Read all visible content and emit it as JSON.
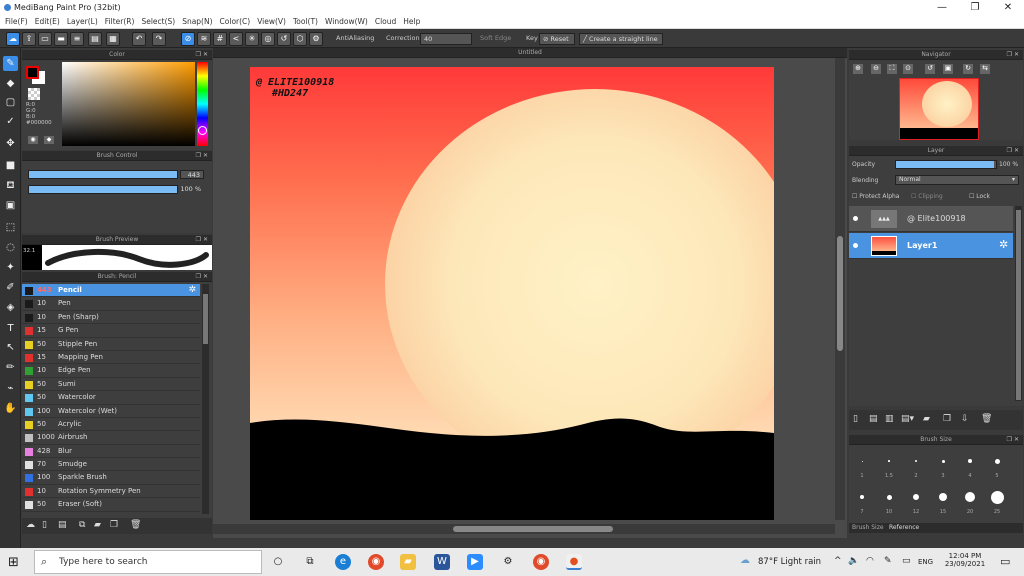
{
  "window": {
    "title": "MediBang Paint Pro (32bit)",
    "min": "—",
    "max": "❐",
    "close": "✕"
  },
  "menu": [
    "File(F)",
    "Edit(E)",
    "Layer(L)",
    "Filter(R)",
    "Select(S)",
    "Snap(N)",
    "Color(C)",
    "View(V)",
    "Tool(T)",
    "Window(W)",
    "Cloud",
    "Help"
  ],
  "toolbar": {
    "antialiasing": "AntiAliasing",
    "correction": "Correction",
    "correction_value": "40",
    "soft_edge": "Soft Edge",
    "key": "Key",
    "reset": "Reset",
    "straight_line": "Create a straight line"
  },
  "color_panel": {
    "title": "Color",
    "r": "R:0",
    "g": "G:0",
    "b": "B:0",
    "hex": "#000000"
  },
  "brush_control": {
    "title": "Brush Control",
    "size": "443",
    "opacity": "100 %"
  },
  "brush_preview": {
    "title": "Brush Preview",
    "size": "32.1"
  },
  "brush_list": {
    "title": "Brush: Pencil",
    "items": [
      {
        "size": "443",
        "name": "Pencil",
        "color": "#1a1a1a"
      },
      {
        "size": "10",
        "name": "Pen",
        "color": "#1a1a1a"
      },
      {
        "size": "10",
        "name": "Pen (Sharp)",
        "color": "#1a1a1a"
      },
      {
        "size": "15",
        "name": "G Pen",
        "color": "#e03030"
      },
      {
        "size": "50",
        "name": "Stipple Pen",
        "color": "#e8d020"
      },
      {
        "size": "15",
        "name": "Mapping Pen",
        "color": "#e03030"
      },
      {
        "size": "10",
        "name": "Edge Pen",
        "color": "#30a030"
      },
      {
        "size": "50",
        "name": "Sumi",
        "color": "#e8d020"
      },
      {
        "size": "50",
        "name": "Watercolor",
        "color": "#60c8f0"
      },
      {
        "size": "100",
        "name": "Watercolor (Wet)",
        "color": "#60c8f0"
      },
      {
        "size": "50",
        "name": "Acrylic",
        "color": "#e8d020"
      },
      {
        "size": "1000",
        "name": "Airbrush",
        "color": "#c0c0c0"
      },
      {
        "size": "428",
        "name": "Blur",
        "color": "#e880e0"
      },
      {
        "size": "70",
        "name": "Smudge",
        "color": "#e0e0e0"
      },
      {
        "size": "100",
        "name": "Sparkle Brush",
        "color": "#3070e0"
      },
      {
        "size": "10",
        "name": "Rotation Symmetry Pen",
        "color": "#e03030"
      },
      {
        "size": "50",
        "name": "Eraser (Soft)",
        "color": "#e0e0e0"
      }
    ]
  },
  "canvas": {
    "title": "Untitled",
    "sig1": "@ ELITE100918",
    "sig2": "#HD247"
  },
  "navigator": {
    "title": "Navigator"
  },
  "layer_panel": {
    "title": "Layer",
    "opacity_label": "Opacity",
    "opacity_value": "100 %",
    "blending_label": "Blending",
    "blending_value": "Normal",
    "protect_alpha": "Protect Alpha",
    "clipping": "Clipping",
    "lock": "Lock",
    "opacity_fraction": 0.98,
    "layers": [
      {
        "name": "@ Elite100918"
      },
      {
        "name": "Layer1"
      }
    ]
  },
  "brush_size": {
    "title": "Brush Size",
    "labels_row1": [
      "1",
      "1.5",
      "2",
      "3",
      "4",
      "5"
    ],
    "labels_row2": [
      "7",
      "10",
      "12",
      "15",
      "20",
      "25"
    ],
    "tabs": [
      "Brush Size",
      "Reference"
    ]
  },
  "taskbar": {
    "search": "Type here to search",
    "weather": "87°F  Light rain",
    "lang": "ENG",
    "time": "12:04 PM",
    "date": "23/09/2021"
  }
}
